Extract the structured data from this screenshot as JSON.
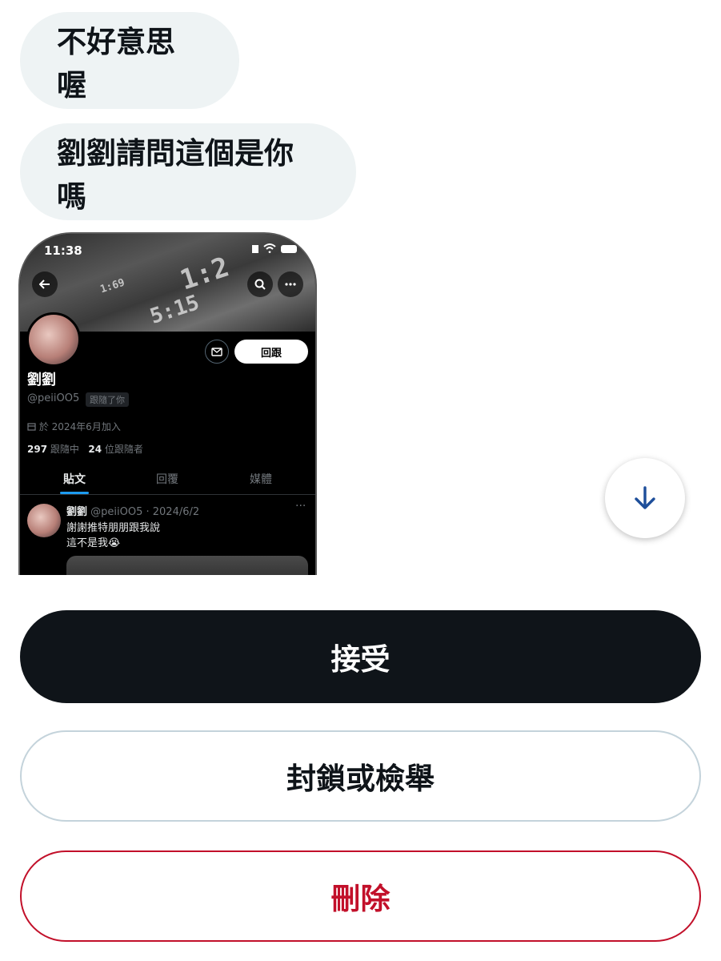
{
  "messages": [
    {
      "text": "不好意思喔"
    },
    {
      "text": "劉劉請問這個是你嗎"
    }
  ],
  "screenshot": {
    "status_time": "11:38",
    "banner_text": [
      "1:69",
      "5:15",
      "1:2"
    ],
    "back_icon": "arrow-left-icon",
    "search_icon": "search-icon",
    "more_icon": "more-horizontal-icon",
    "follow_back_label": "回跟",
    "profile_name": "劉劉",
    "profile_handle": "@peiiOO5",
    "follows_you_badge": "跟隨了你",
    "joined": "於 2024年6月加入",
    "following_count": "297",
    "following_label": "跟隨中",
    "followers_count": "24",
    "followers_label": "位跟隨者",
    "tabs": [
      {
        "label": "貼文"
      },
      {
        "label": "回覆"
      },
      {
        "label": "媒體"
      }
    ],
    "tweet": {
      "name": "劉劉",
      "meta": "@peiiOO5 · 2024/6/2",
      "line1": "謝謝推特朋朋跟我說",
      "line2": "這不是我😭",
      "more": "···"
    }
  },
  "scroll_down_icon": "arrow-down-icon",
  "actions": {
    "accept_label": "接受",
    "block_label": "封鎖或檢舉",
    "delete_label": "刪除"
  },
  "colors": {
    "bubble_bg": "#eef3f4",
    "accept_bg": "#0f1419",
    "delete_red": "#c2102a",
    "twitter_blue": "#1d9bf0",
    "scroll_arrow": "#1d4e9a"
  }
}
